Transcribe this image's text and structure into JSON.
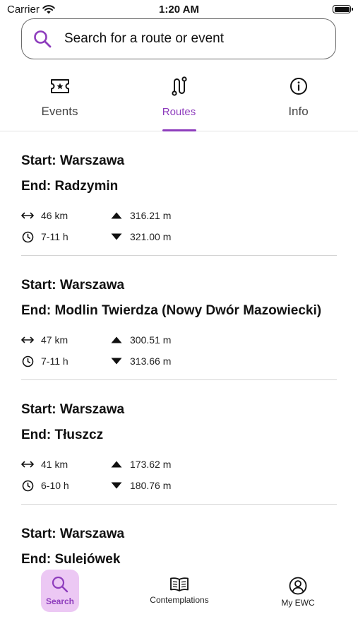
{
  "status_bar": {
    "carrier": "Carrier",
    "time": "1:20 AM"
  },
  "search": {
    "placeholder": "Search for a route or event"
  },
  "tabs": [
    {
      "label": "Events",
      "icon": "ticket-icon",
      "active": false
    },
    {
      "label": "Routes",
      "icon": "route-icon",
      "active": true
    },
    {
      "label": "Info",
      "icon": "info-icon",
      "active": false
    }
  ],
  "routes": [
    {
      "start": "Start: Warszawa",
      "end": "End: Radzymin",
      "distance": "46 km",
      "duration": "7-11 h",
      "ascent": "316.21 m",
      "descent": "321.00 m"
    },
    {
      "start": "Start: Warszawa",
      "end": "End: Modlin Twierdza (Nowy Dwór Mazowiecki)",
      "distance": "47 km",
      "duration": "7-11 h",
      "ascent": "300.51 m",
      "descent": "313.66 m"
    },
    {
      "start": "Start: Warszawa",
      "end": "End: Tłuszcz",
      "distance": "41 km",
      "duration": "6-10 h",
      "ascent": "173.62 m",
      "descent": "180.76 m"
    },
    {
      "start": "Start: Warszawa",
      "end": "End: Sulejówek",
      "distance": "",
      "duration": "",
      "ascent": "",
      "descent": ""
    }
  ],
  "bottom_nav": {
    "search": "Search",
    "contemplations": "Contemplations",
    "my_ewc": "My EWC"
  },
  "colors": {
    "accent": "#8e3dbd",
    "accent_bg": "#ecc8f4",
    "divider": "#d4d4d4"
  }
}
